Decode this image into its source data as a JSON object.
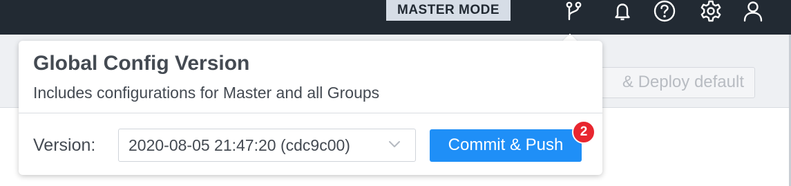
{
  "topbar": {
    "mode_label": "MASTER MODE",
    "icons": [
      "git-branch-icon",
      "bell-icon",
      "help-icon",
      "gear-icon",
      "user-icon"
    ]
  },
  "background": {
    "deploy_button_label": "& Deploy default"
  },
  "popover": {
    "title": "Global Config Version",
    "subtitle": "Includes configurations for Master and all Groups",
    "version_label": "Version:",
    "version_value": "2020-08-05 21:47:20 (cdc9c00)",
    "commit_button_label": "Commit & Push",
    "commit_count": "2"
  },
  "colors": {
    "topbar": "#222a33",
    "accent": "#1f8ff7",
    "badge": "#e8262f"
  }
}
